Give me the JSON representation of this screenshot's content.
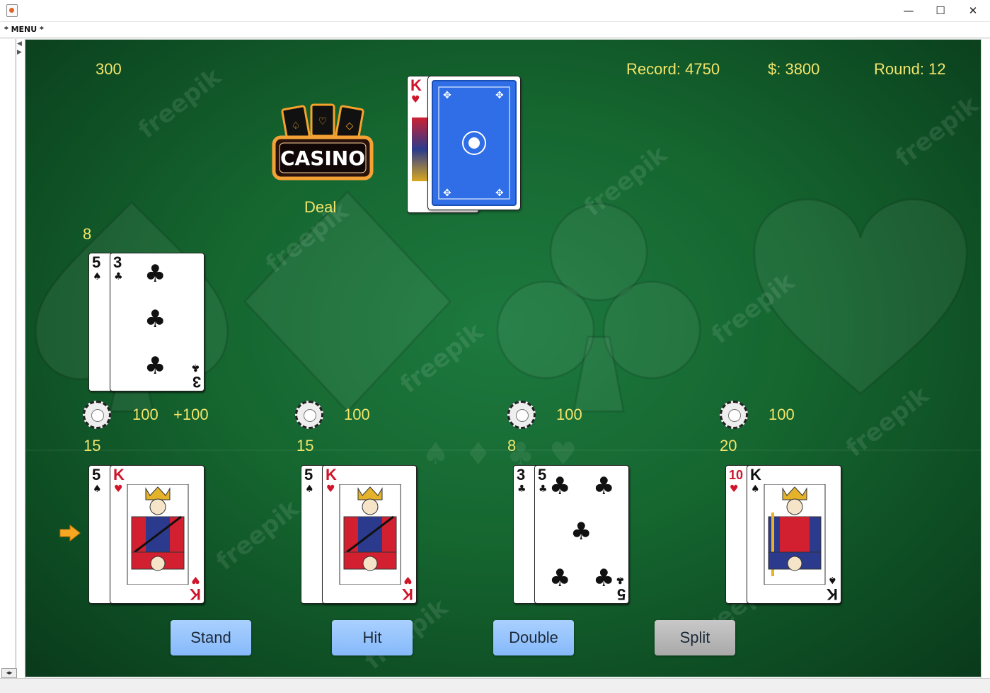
{
  "window": {
    "controls": {
      "minimize": "—",
      "maximize": "☐",
      "close": "✕"
    }
  },
  "menu": {
    "label": "* MENU *"
  },
  "hud": {
    "dealer_bet": "300",
    "record": "Record: 4750",
    "money": "$: 3800",
    "round": "Round: 12"
  },
  "logo": {
    "text": "CASINO"
  },
  "deal_label": "Deal",
  "watermark": "freepik",
  "dealer": {
    "score": "8",
    "cards": [
      {
        "rank": "5",
        "suit": "♠",
        "color": "black"
      },
      {
        "rank": "3",
        "suit": "♣",
        "color": "black"
      }
    ]
  },
  "deck_top": {
    "rank": "K",
    "suit": "♥",
    "color": "red"
  },
  "hands": [
    {
      "bet": "100",
      "result": "+100",
      "score": "15",
      "active": true,
      "cards": [
        {
          "rank": "5",
          "suit": "♠",
          "color": "black"
        },
        {
          "rank": "K",
          "suit": "♥",
          "color": "red"
        }
      ]
    },
    {
      "bet": "100",
      "result": "",
      "score": "15",
      "active": false,
      "cards": [
        {
          "rank": "5",
          "suit": "♠",
          "color": "black"
        },
        {
          "rank": "K",
          "suit": "♥",
          "color": "red"
        }
      ]
    },
    {
      "bet": "100",
      "result": "",
      "score": "8",
      "active": false,
      "cards": [
        {
          "rank": "3",
          "suit": "♣",
          "color": "black"
        },
        {
          "rank": "5",
          "suit": "♣",
          "color": "black"
        }
      ]
    },
    {
      "bet": "100",
      "result": "",
      "score": "20",
      "active": false,
      "cards": [
        {
          "rank": "10",
          "suit": "♥",
          "color": "red"
        },
        {
          "rank": "K",
          "suit": "♠",
          "color": "black"
        }
      ]
    }
  ],
  "buttons": {
    "stand": "Stand",
    "hit": "Hit",
    "double": "Double",
    "split": "Split"
  },
  "colors": {
    "felt": "#15652f",
    "hud_text": "#f2e56b",
    "button_blue": "#86b9fa",
    "button_disabled": "#a9a9a9"
  }
}
